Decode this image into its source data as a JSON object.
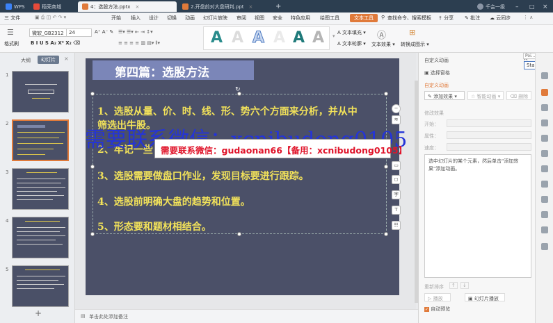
{
  "titlebar": {
    "app": "WPS",
    "tabs": [
      "稻壳商城",
      "4：选股方法.pptx",
      "2.开盘前对大盘研判.ppt"
    ],
    "new_tab": "+",
    "user": "千会一级"
  },
  "menu": {
    "file": "三 文件",
    "items": [
      "开始",
      "插入",
      "设计",
      "切换",
      "动画",
      "幻灯片放映",
      "审阅",
      "视图",
      "安全",
      "特色应用",
      "绘图工具",
      "文本工具"
    ],
    "search": "查找命令、搜索模板",
    "share": "分享",
    "comment": "批注",
    "sync": "云同步"
  },
  "ribbon": {
    "format_painter": "格式刷",
    "font_name": "微软_GB2312",
    "font_size": "24",
    "wordart": [
      "A",
      "A",
      "A",
      "A",
      "A",
      "A"
    ],
    "text_fill": "文本填充",
    "text_outline": "文本轮廓",
    "text_effect": "文本效果",
    "convert": "转换成图示"
  },
  "leftpanel": {
    "tab_outline": "大纲",
    "tab_slides": "幻灯片",
    "slide_numbers": [
      "1",
      "2",
      "3",
      "4",
      "5"
    ],
    "add": "+"
  },
  "slide": {
    "title": "第四篇：选股方法",
    "lines": [
      "1、选股从量、价、时、线、形、势六个方面来分析，并从中",
      "筛选出牛股。",
      "2、牢记一些",
      "3、选股需要做盘口作业，发现目标要进行跟踪。",
      "4、选股前明确大盘的趋势和位置。",
      "5、形态要和题材相结合。"
    ]
  },
  "watermark": {
    "large": "需要联系微信：xcnibudong0105",
    "banner": "需要联系微信：gudaonan66【备用：xcnibudong0105】"
  },
  "rightpanel": {
    "header": "自定义动画",
    "select_pane": "选择窗格",
    "section": "自定义动画",
    "add_effect": "添加效果",
    "smart_anim": "智能动画",
    "delete": "删除",
    "modify": "修改效果",
    "start": "开始：",
    "property": "属性：",
    "speed": "速度：",
    "hint": "选中幻灯片的某个元素，然后单击\"添加效果\"添加动画。",
    "reorder": "重新排序",
    "play": "播放",
    "slideshow": "幻灯片播放",
    "autopreview": "自动预览",
    "tooltip_small": "Poi...",
    "tooltip_start": "Start"
  },
  "statusbar": {
    "notes": "单击此处添加备注"
  },
  "colors": {
    "accent": "#e07a3a",
    "slide_bg": "#4b5068",
    "slide_text": "#f2e25a"
  }
}
